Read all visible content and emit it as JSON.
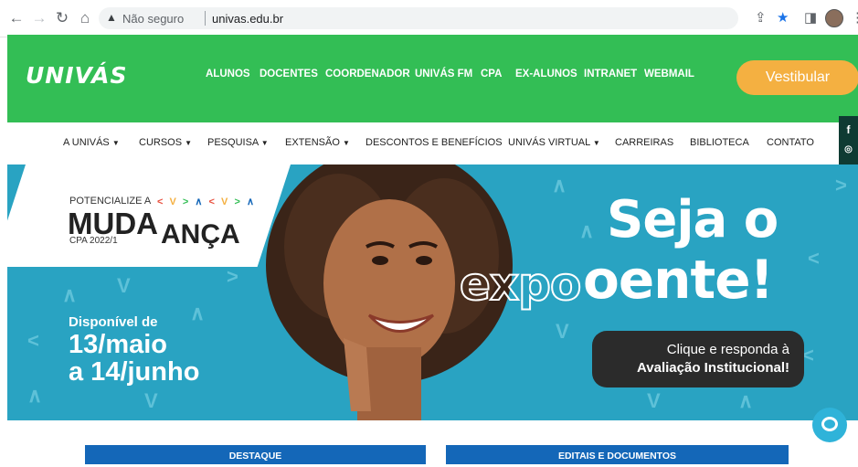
{
  "browser": {
    "security_label": "Não seguro",
    "url": "univas.edu.br",
    "icons": [
      "back-icon",
      "forward-icon",
      "reload-icon",
      "home-icon",
      "warning-icon",
      "share-icon",
      "star-icon",
      "sidebar-icon",
      "avatar",
      "menu-icon"
    ]
  },
  "header": {
    "logo": "UNIVÁS",
    "menu": [
      "ALUNOS",
      "DOCENTES",
      "COORDENADOR",
      "UNIVÁS FM",
      "CPA",
      "EX-ALUNOS",
      "INTRANET",
      "WEBMAIL"
    ],
    "cta": "Vestibular",
    "colors": {
      "green": "#33be55",
      "cta": "#f4b041"
    }
  },
  "secondary_menu": [
    {
      "label": "A UNIVÁS",
      "dropdown": true
    },
    {
      "label": "CURSOS",
      "dropdown": true
    },
    {
      "label": "PESQUISA",
      "dropdown": true
    },
    {
      "label": "EXTENSÃO",
      "dropdown": true
    },
    {
      "label": "DESCONTOS E BENEFÍCIOS",
      "dropdown": false
    },
    {
      "label": "UNIVÁS VIRTUAL",
      "dropdown": true
    },
    {
      "label": "CARREIRAS",
      "dropdown": false
    },
    {
      "label": "BIBLIOTECA",
      "dropdown": false
    },
    {
      "label": "CONTATO",
      "dropdown": false
    }
  ],
  "social": [
    "facebook-icon",
    "instagram-icon",
    "youtube-icon",
    "linkedin-icon"
  ],
  "hero": {
    "card_line1": "POTENCIALIZE A",
    "card_arrows": "< V > ∧ < V > ∧",
    "card_mud": "MUDA",
    "card_anca": "ANÇA",
    "card_cpa": "CPA 2022/1",
    "headline_1": "Seja o",
    "headline_2_outline": "expo",
    "headline_2_fill": "oente!",
    "available_label": "Disponível de",
    "date_1": "13/maio",
    "date_2": "a 14/junho",
    "cta_line1": "Clique e responda à",
    "cta_line2": "Avaliação Institucional!",
    "colors": {
      "bg": "#29a3c2",
      "pattern": "#5ec1d8",
      "cta_box": "#2b2b2b"
    }
  },
  "sections": [
    "DESTAQUE",
    "EDITAIS E DOCUMENTOS"
  ],
  "chat": {
    "icon": "chat-icon"
  }
}
